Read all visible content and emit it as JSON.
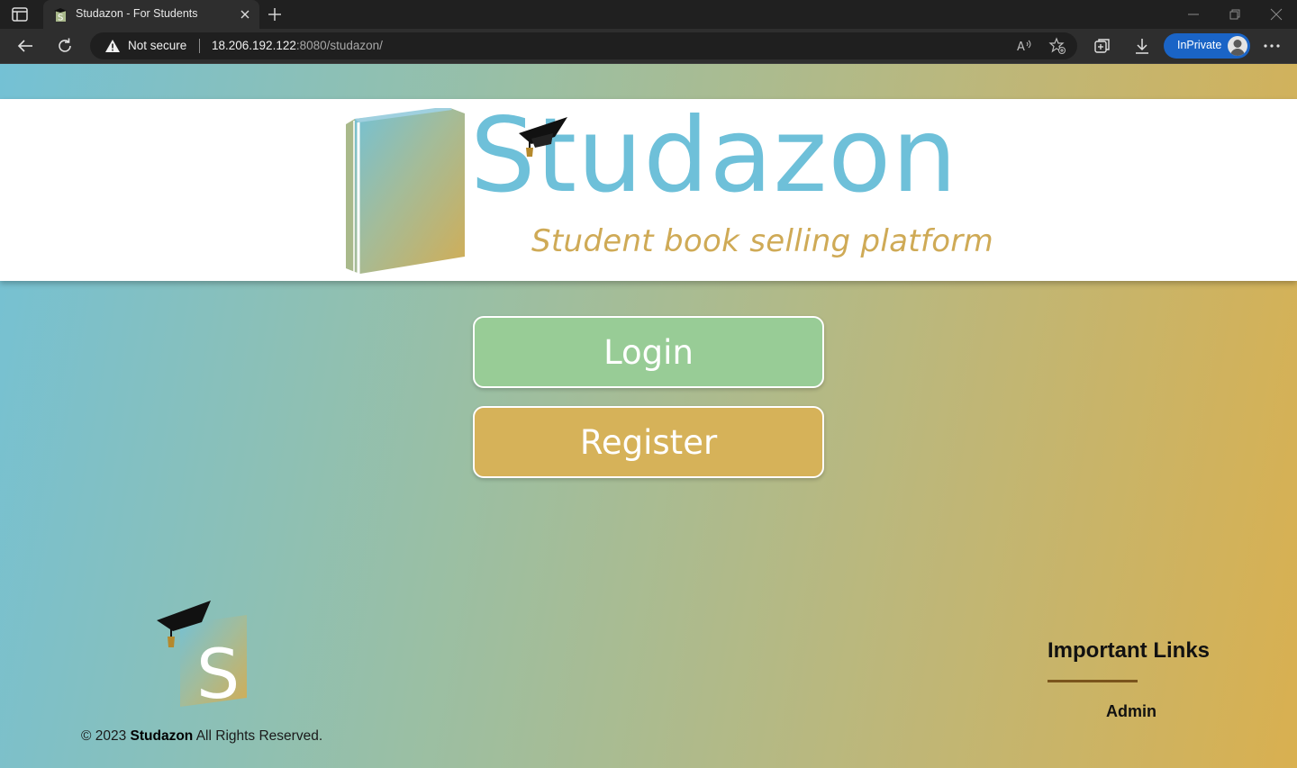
{
  "browser": {
    "tab_title": "Studazon - For Students",
    "security_label": "Not secure",
    "url_host": "18.206.192.122",
    "url_rest": ":8080/studazon/",
    "inprivate_label": "InPrivate"
  },
  "header": {
    "brand_name": "Studazon",
    "tagline": "Student book selling platform"
  },
  "main": {
    "login_label": "Login",
    "register_label": "Register"
  },
  "footer": {
    "copyright_prefix": "© 2023 ",
    "copyright_brand": "Studazon",
    "copyright_suffix": " All Rights Reserved.",
    "links_title": "Important Links",
    "admin_link": "Admin",
    "logo_letter": "S"
  },
  "colors": {
    "brand_blue": "#6ec0d9",
    "brand_gold": "#cfaa56",
    "login_button": "#98cc96",
    "register_button": "#d6b259"
  }
}
